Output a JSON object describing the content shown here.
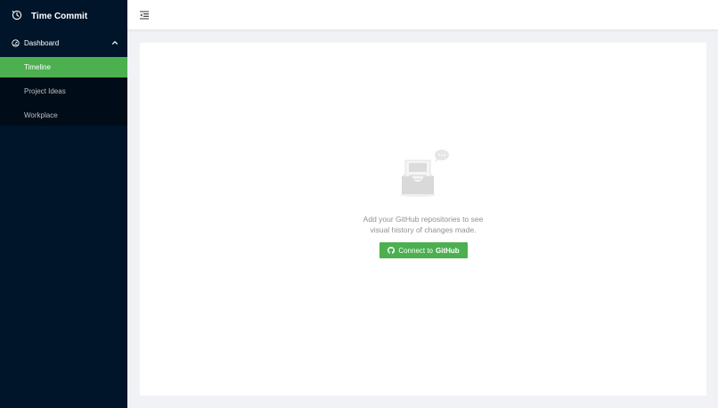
{
  "app": {
    "name": "Time Commit",
    "logo_icon": "clock-icon"
  },
  "colors": {
    "sidebar_bg": "#001529",
    "submenu_bg": "#000c17",
    "accent": "#4caf50",
    "page_bg": "#f0f2f5"
  },
  "sidebar": {
    "group": {
      "label": "Dashboard",
      "icon": "dashboard-icon",
      "expanded": true,
      "items": [
        {
          "label": "Timeline",
          "active": true
        },
        {
          "label": "Project Ideas",
          "active": false
        },
        {
          "label": "Workplace",
          "active": false
        }
      ]
    }
  },
  "header": {
    "fold_icon": "menu-fold-icon"
  },
  "empty_state": {
    "illustration": "empty-inbox-icon",
    "line1": "Add your GitHub repositories to see",
    "line2": "visual history of changes made.",
    "button": {
      "prefix": "Connect to",
      "strong": "GitHub",
      "icon": "github-icon"
    }
  }
}
